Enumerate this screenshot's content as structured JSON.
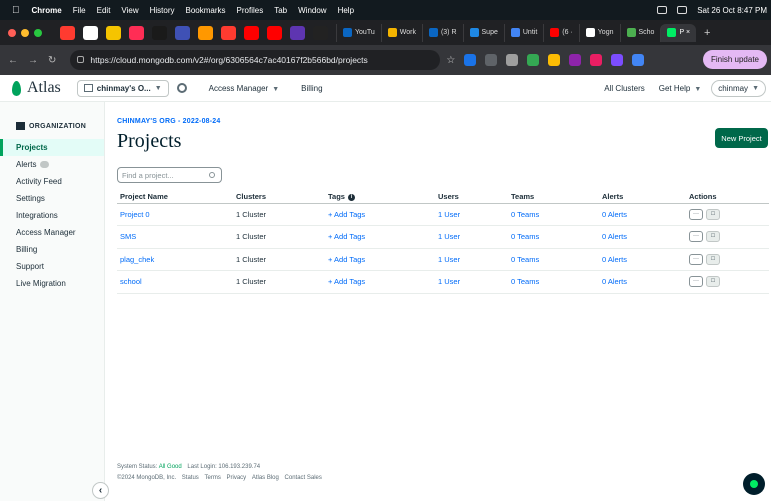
{
  "menubar": {
    "app": "Chrome",
    "items": [
      "File",
      "Edit",
      "View",
      "History",
      "Bookmarks",
      "Profiles",
      "Tab",
      "Window",
      "Help"
    ],
    "clock": "Sat 26 Oct  8:47 PM"
  },
  "tabs": [
    {
      "label": "YouTu",
      "color": "#0a66c2"
    },
    {
      "label": "Work",
      "color": "#f4b400"
    },
    {
      "label": "(3) R",
      "color": "#0a66c2"
    },
    {
      "label": "Supe",
      "color": "#1e88e5"
    },
    {
      "label": "Untit",
      "color": "#4285f4"
    },
    {
      "label": "(6 ·",
      "color": "#ff0000"
    },
    {
      "label": "Yogn",
      "color": "#ffffff"
    },
    {
      "label": "Scho",
      "color": "#4caf50"
    },
    {
      "label": "P ×",
      "color": "#00ed64",
      "active": true
    }
  ],
  "address": {
    "url": "https://cloud.mongodb.com/v2#/org/6306564c7ac40167f2b566bd/projects",
    "finish_update": "Finish update"
  },
  "atlas": {
    "logo": "Atlas",
    "org_selector": "chinmay's O...",
    "access_manager": "Access Manager",
    "billing": "Billing",
    "all_clusters": "All Clusters",
    "get_help": "Get Help",
    "user": "chinmay"
  },
  "sidebar": {
    "header": "ORGANIZATION",
    "items": [
      {
        "label": "Projects",
        "active": true
      },
      {
        "label": "Alerts"
      },
      {
        "label": "Activity Feed"
      },
      {
        "label": "Settings"
      },
      {
        "label": "Integrations"
      },
      {
        "label": "Access Manager"
      },
      {
        "label": "Billing"
      },
      {
        "label": "Support"
      },
      {
        "label": "Live Migration"
      }
    ]
  },
  "main": {
    "breadcrumb": "CHINMAY'S ORG - 2022-08-24",
    "title": "Projects",
    "new_project": "New Project",
    "search_placeholder": "Find a project...",
    "columns": [
      "Project Name",
      "Clusters",
      "Tags",
      "Users",
      "Teams",
      "Alerts",
      "Actions"
    ],
    "rows": [
      {
        "name": "Project 0",
        "clusters": "1 Cluster",
        "tags": "+ Add Tags",
        "users": "1 User",
        "teams": "0 Teams",
        "alerts": "0 Alerts"
      },
      {
        "name": "SMS",
        "clusters": "1 Cluster",
        "tags": "+ Add Tags",
        "users": "1 User",
        "teams": "0 Teams",
        "alerts": "0 Alerts"
      },
      {
        "name": "plag_chek",
        "clusters": "1 Cluster",
        "tags": "+ Add Tags",
        "users": "1 User",
        "teams": "0 Teams",
        "alerts": "0 Alerts"
      },
      {
        "name": "school",
        "clusters": "1 Cluster",
        "tags": "+ Add Tags",
        "users": "1 User",
        "teams": "0 Teams",
        "alerts": "0 Alerts"
      }
    ]
  },
  "footer": {
    "status_label": "System Status:",
    "status_value": "All Good",
    "last_login": "Last Login: 106.193.239.74",
    "copyright": "©2024 MongoDB, Inc.",
    "links": [
      "Status",
      "Terms",
      "Privacy",
      "Atlas Blog",
      "Contact Sales"
    ]
  },
  "icons": {
    "pinned_tabs": [
      "#ff3b30",
      "#ffffff",
      "#f5c400",
      "#ff2d55",
      "#1a1a1a",
      "#3f51b5",
      "#ff9800",
      "#ff3b30",
      "#ff0000",
      "#ff0000",
      "#5e35b1",
      "#222222"
    ]
  },
  "colors": {
    "accent": "#00684a",
    "link": "#016bf8",
    "leaf": "#00a35c"
  }
}
